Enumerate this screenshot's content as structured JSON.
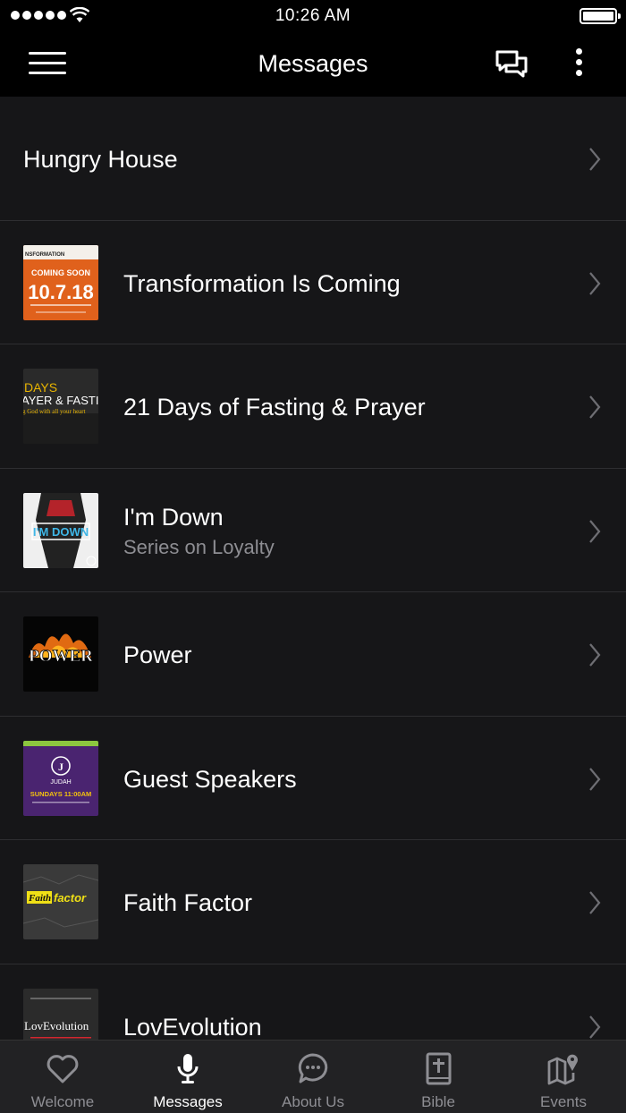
{
  "status_bar": {
    "time": "10:26 AM"
  },
  "nav": {
    "title": "Messages"
  },
  "messages": [
    {
      "title": "Hungry House",
      "subtitle": ""
    },
    {
      "title": "Transformation Is Coming",
      "subtitle": "",
      "thumb_text": [
        "NSFORMATION",
        "COMING SOON",
        "10.7.18"
      ]
    },
    {
      "title": "21 Days of Fasting & Prayer",
      "subtitle": "",
      "thumb_text": [
        "DAYS",
        "AYER & FASTI",
        "g God with all your heart"
      ]
    },
    {
      "title": "I'm Down",
      "subtitle": "Series on Loyalty",
      "thumb_text": [
        "I'M DOWN"
      ]
    },
    {
      "title": "Power",
      "subtitle": "",
      "thumb_text": [
        "POWER"
      ]
    },
    {
      "title": "Guest Speakers",
      "subtitle": "",
      "thumb_text": [
        "JUDAH",
        "SUNDAYS 11:00AM"
      ]
    },
    {
      "title": "Faith Factor",
      "subtitle": "",
      "thumb_text": [
        "Faith",
        "factor"
      ]
    },
    {
      "title": "LovEvolution",
      "subtitle": "",
      "thumb_text": [
        "LovEvolution"
      ]
    }
  ],
  "tabs": [
    {
      "label": "Welcome",
      "icon": "heart-icon",
      "active": false
    },
    {
      "label": "Messages",
      "icon": "microphone-icon",
      "active": true
    },
    {
      "label": "About Us",
      "icon": "chat-bubble-icon",
      "active": false
    },
    {
      "label": "Bible",
      "icon": "bible-icon",
      "active": false
    },
    {
      "label": "Events",
      "icon": "map-pin-icon",
      "active": false
    }
  ],
  "colors": {
    "background": "#161618",
    "bar": "#000000",
    "tab_bar": "#222224",
    "inactive": "#8e8e93",
    "separator": "#2e2e31"
  }
}
